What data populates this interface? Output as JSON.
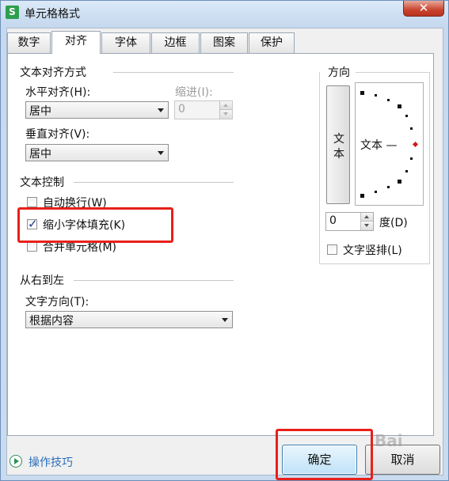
{
  "window": {
    "title": "单元格格式",
    "app_icon": "S",
    "close_symbol": "✕"
  },
  "tabs": [
    {
      "label": "数字"
    },
    {
      "label": "对齐",
      "active": true
    },
    {
      "label": "字体"
    },
    {
      "label": "边框"
    },
    {
      "label": "图案"
    },
    {
      "label": "保护"
    }
  ],
  "alignment": {
    "group_title": "文本对齐方式",
    "horizontal_label": "水平对齐(H):",
    "horizontal_value": "居中",
    "indent_label": "缩进(I):",
    "indent_value": "0",
    "vertical_label": "垂直对齐(V):",
    "vertical_value": "居中"
  },
  "text_control": {
    "group_title": "文本控制",
    "wrap_label": "自动换行(W)",
    "wrap_checked": false,
    "shrink_label": "缩小字体填充(K)",
    "shrink_checked": true,
    "merge_label": "合并单元格(M)",
    "merge_checked": false
  },
  "rtl": {
    "group_title": "从右到左",
    "direction_label": "文字方向(T):",
    "direction_value": "根据内容"
  },
  "orientation": {
    "group_title": "方向",
    "vertical_text_char1": "文",
    "vertical_text_char2": "本",
    "dial_text": "文本 —",
    "degree_value": "0",
    "degree_label": "度(D)",
    "vertical_text_label": "文字竖排(L)",
    "vertical_text_checked": false
  },
  "footer": {
    "tips_label": "操作技巧",
    "ok_label": "确定",
    "cancel_label": "取消"
  },
  "watermark": "Bai",
  "colors": {
    "highlight_red": "#e8201a",
    "link_blue": "#2a6ebb",
    "check_blue": "#1a3a8c"
  }
}
